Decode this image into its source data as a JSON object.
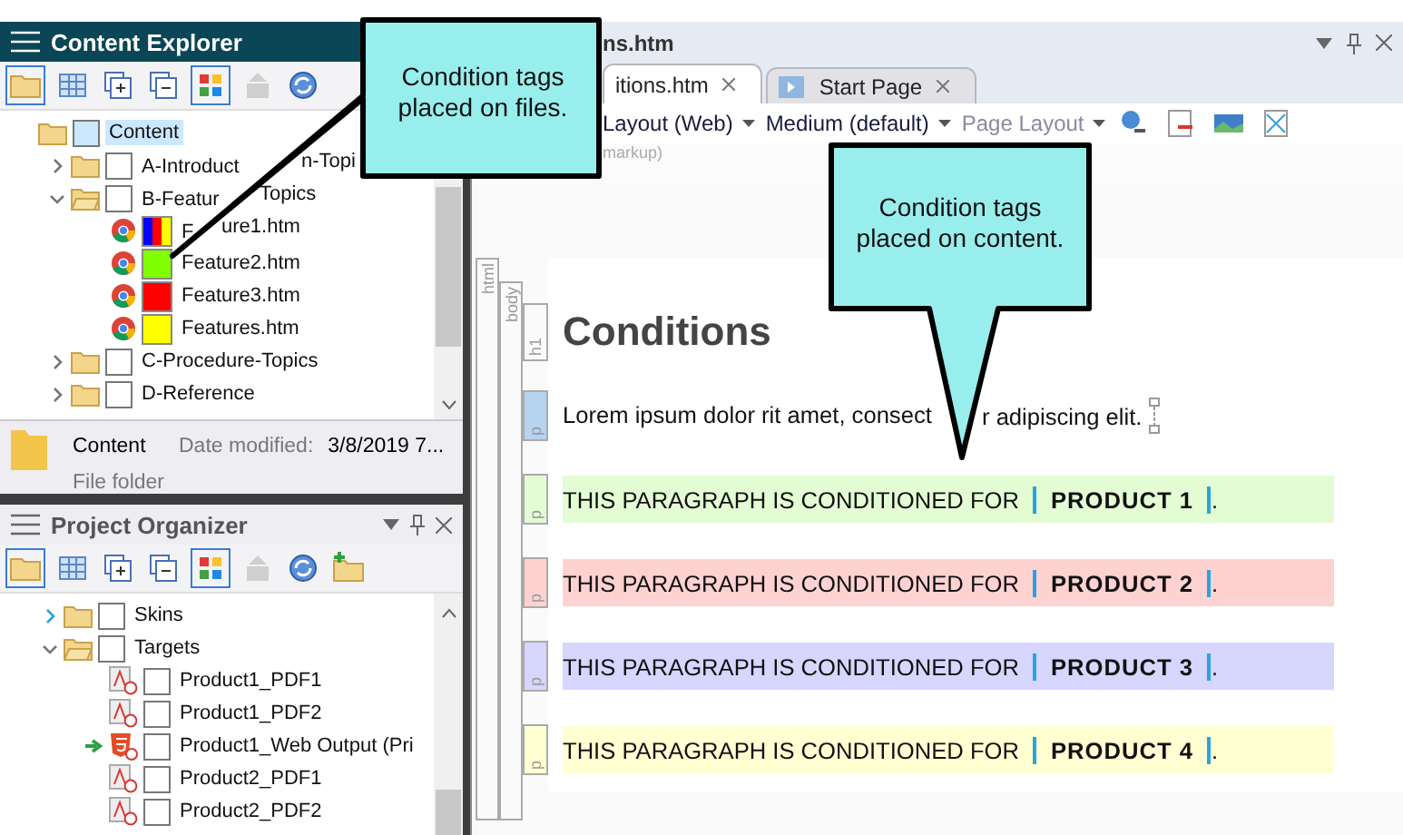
{
  "content_explorer": {
    "title": "Content Explorer",
    "tree": [
      {
        "parts": [
          "Content"
        ],
        "kind": "folder",
        "selected": true,
        "checked": false,
        "children": [
          {
            "parts": [
              "A-Introduct",
              "n-Topi"
            ],
            "kind": "folder",
            "expanded": false,
            "selected": false,
            "checked": false
          },
          {
            "parts": [
              "B-Featur",
              "Topics"
            ],
            "kind": "folder",
            "expanded": true,
            "selected": false,
            "checked": false,
            "children": [
              {
                "parts": [
                  "F",
                  "ure1.htm"
                ],
                "kind": "file",
                "selected": false,
                "tags": [
                  {
                    "color": "#0000ff"
                  },
                  {
                    "color": "#ff0000"
                  },
                  {
                    "color": "#ffff00"
                  }
                ]
              },
              {
                "parts": [
                  "Feature2.htm"
                ],
                "kind": "file",
                "selected": false,
                "tags": [
                  {
                    "color": "#80ff00"
                  }
                ]
              },
              {
                "parts": [
                  "Feature3.htm"
                ],
                "kind": "file",
                "selected": false,
                "tags": [
                  {
                    "color": "#ff0000"
                  }
                ]
              },
              {
                "parts": [
                  "Features.htm"
                ],
                "kind": "file",
                "selected": false,
                "tags": [
                  {
                    "color": "#ffff00"
                  }
                ]
              }
            ]
          },
          {
            "parts": [
              "C-Procedure-Topics"
            ],
            "kind": "folder",
            "expanded": false,
            "selected": false,
            "checked": false
          },
          {
            "parts": [
              "D-Reference"
            ],
            "kind": "folder",
            "expanded": false,
            "selected": false,
            "checked": false
          }
        ]
      }
    ],
    "info": {
      "name": "Content",
      "date_label": "Date modified:",
      "date": "3/8/2019 7...",
      "type": "File folder"
    }
  },
  "project_organizer": {
    "title": "Project Organizer",
    "tree": [
      {
        "label": "Skins",
        "kind": "folder",
        "expanded": false,
        "checked": false
      },
      {
        "label": "Targets",
        "kind": "folder",
        "expanded": true,
        "checked": false,
        "children": [
          {
            "label": "Product1_PDF1",
            "kind": "pdf",
            "primary": false,
            "checked": false
          },
          {
            "label": "Product1_PDF2",
            "kind": "pdf",
            "primary": false,
            "checked": false
          },
          {
            "label": "Product1_Web Output (Pri",
            "kind": "html5",
            "primary": true,
            "checked": false
          },
          {
            "label": "Product2_PDF1",
            "kind": "pdf",
            "primary": false,
            "checked": false
          },
          {
            "label": "Product2_PDF2",
            "kind": "pdf",
            "primary": false,
            "checked": false
          }
        ]
      }
    ]
  },
  "editor": {
    "title": "ns.htm",
    "tabs": [
      {
        "label": "itions.htm",
        "selected": true
      },
      {
        "label": "Start Page",
        "selected": false
      }
    ],
    "toolbar": [
      {
        "label": "Layout (Web)",
        "disabled": false
      },
      {
        "label": "Medium (default)",
        "disabled": false
      },
      {
        "label": "Page Layout",
        "disabled": true
      }
    ],
    "hint": "markup)",
    "structure": {
      "html": "html",
      "body": "body"
    },
    "blocks": [
      {
        "kind": "heading",
        "tag": "h1",
        "text": "Conditions"
      },
      {
        "kind": "paragraph",
        "tag": "p",
        "parts": [
          "Lorem ipsum dolor rit amet, consect",
          "r adipiscing elit."
        ],
        "selected": true
      },
      {
        "kind": "conditioned",
        "tag": "p",
        "text": "THIS PARAGRAPH IS CONDITIONED FOR ",
        "tagged": "PRODUCT 1",
        "end": ".",
        "color": "#e4fcd4"
      },
      {
        "kind": "conditioned",
        "tag": "p",
        "text": "THIS PARAGRAPH IS CONDITIONED FOR ",
        "tagged": "PRODUCT 2",
        "end": ".",
        "color": "#ffd2d2"
      },
      {
        "kind": "conditioned",
        "tag": "p",
        "text": "THIS PARAGRAPH IS CONDITIONED FOR ",
        "tagged": "PRODUCT 3",
        "end": ".",
        "color": "#d6d6ff"
      },
      {
        "kind": "conditioned",
        "tag": "p",
        "text": "THIS PARAGRAPH IS CONDITIONED FOR ",
        "tagged": "PRODUCT 4",
        "end": ".",
        "color": "#ffffd2"
      }
    ]
  },
  "callouts": [
    {
      "text": "Condition tags placed on files."
    },
    {
      "text": "Condition tags placed on content."
    }
  ]
}
